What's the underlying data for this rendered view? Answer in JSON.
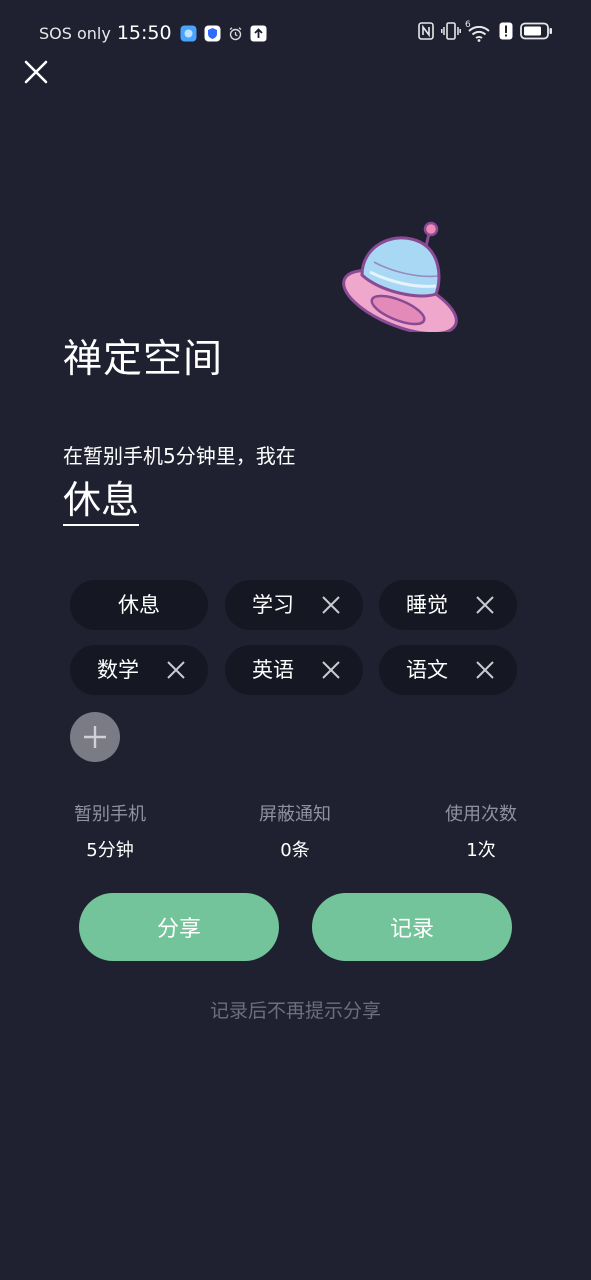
{
  "status_bar": {
    "carrier": "SOS only",
    "time": "15:50",
    "network_label": "6",
    "icons": [
      "gallery-app-icon",
      "shield-app-icon",
      "alarm-icon",
      "upload-icon",
      "nfc-icon",
      "vibrate-icon",
      "wifi-icon",
      "alert-icon",
      "battery-icon"
    ]
  },
  "header": {
    "close_icon": "close-icon"
  },
  "main": {
    "title": "禅定空间",
    "subtitle": "在暂别手机5分钟里，我在",
    "current_activity": "休息"
  },
  "chips": [
    {
      "label": "休息",
      "removable": false
    },
    {
      "label": "学习",
      "removable": true
    },
    {
      "label": "睡觉",
      "removable": true
    },
    {
      "label": "数学",
      "removable": true
    },
    {
      "label": "英语",
      "removable": true
    },
    {
      "label": "语文",
      "removable": true
    }
  ],
  "stats": [
    {
      "label": "暂别手机",
      "value": "5分钟"
    },
    {
      "label": "屏蔽通知",
      "value": "0条"
    },
    {
      "label": "使用次数",
      "value": "1次"
    }
  ],
  "actions": {
    "share_label": "分享",
    "record_label": "记录"
  },
  "hint": "记录后不再提示分享",
  "colors": {
    "background": "#1f2130",
    "chip": "#151722",
    "accent": "#73c49a",
    "muted": "#8f90a0"
  }
}
